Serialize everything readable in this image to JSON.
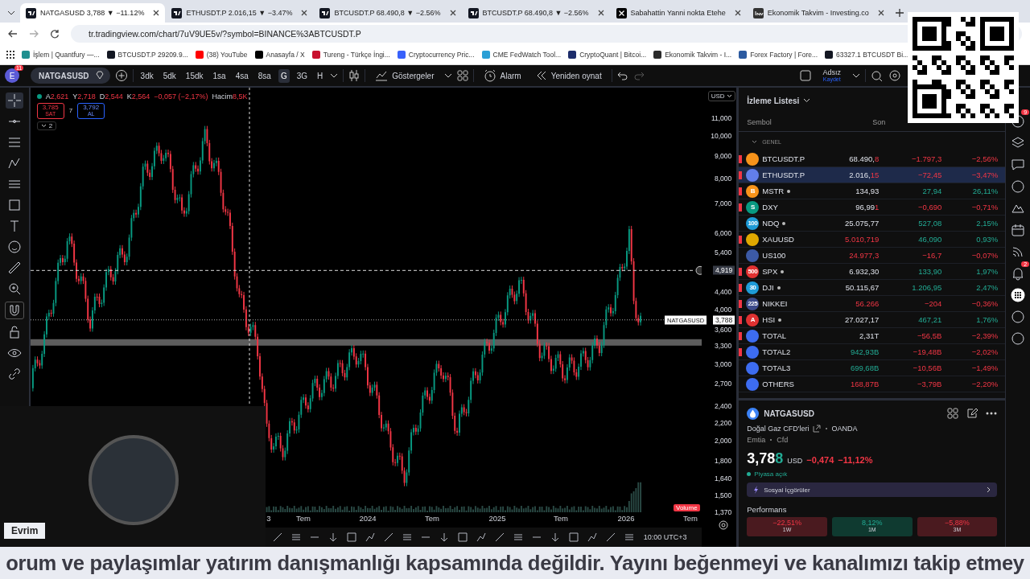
{
  "browser": {
    "tabs": [
      {
        "kind": "tv",
        "title": "NATGASUSD 3,788 ▼ −11.12%",
        "selected": true
      },
      {
        "kind": "tv",
        "title": "ETHUSDT.P 2.016,15 ▼ −3.47%",
        "selected": false
      },
      {
        "kind": "tv",
        "title": "BTCUSDT.P 68.490,8 ▼ −2.56%",
        "selected": false
      },
      {
        "kind": "tv",
        "title": "BTCUSDT.P 68.490,8 ▼ −2.56%",
        "selected": false
      },
      {
        "kind": "x",
        "title": "Sabahattin Yanni nokta Etehe",
        "selected": false
      },
      {
        "kind": "inv",
        "title": "Ekonomik Takvim - Investing.co",
        "selected": false
      }
    ],
    "url": "tr.tradingview.com/chart/7uV9UE5v/?symbol=BINANCE%3ABTCUSDT.P",
    "bookmarks": [
      {
        "title": "İşlem | Quantfury —...",
        "color": "#1f8f8f"
      },
      {
        "title": "BTCUSDT.P 29209.9...",
        "color": "#131722"
      },
      {
        "title": "(38) YouTube",
        "color": "#ff0000"
      },
      {
        "title": "Anasayfa / X",
        "color": "#000000"
      },
      {
        "title": "Tureng - Türkçe İngi...",
        "color": "#c8102e"
      },
      {
        "title": "Cryptocurrency Pric...",
        "color": "#3861fb"
      },
      {
        "title": "CME FedWatch Tool...",
        "color": "#2a9fd6"
      },
      {
        "title": "CryptoQuant | Bitcoi...",
        "color": "#1d2d6b"
      },
      {
        "title": "Ekonomik Takvim - I...",
        "color": "#2b2b2b"
      },
      {
        "title": "Forex Factory | Fore...",
        "color": "#2c5aa0"
      },
      {
        "title": "63327.1 BTCUSDT Bi...",
        "color": "#131722"
      }
    ]
  },
  "toolbar": {
    "avatar": "E",
    "notifications": "11",
    "symbol": "NATGASUSD",
    "intervals": [
      {
        "label": "3dk",
        "selected": false
      },
      {
        "label": "5dk",
        "selected": false
      },
      {
        "label": "15dk",
        "selected": false
      },
      {
        "label": "1sa",
        "selected": false
      },
      {
        "label": "4sa",
        "selected": false
      },
      {
        "label": "8sa",
        "selected": false
      },
      {
        "label": "G",
        "selected": true
      },
      {
        "label": "3G",
        "selected": false
      },
      {
        "label": "H",
        "selected": false
      }
    ],
    "indicators": "Göstergeler",
    "alert": "Alarm",
    "replay": "Yeniden oynat",
    "layout_name": "Adsız",
    "layout_save": "Kaydet"
  },
  "chart": {
    "legend": [
      {
        "label": "A",
        "value": "2,621"
      },
      {
        "label": "Y",
        "value": "2,718"
      },
      {
        "label": "D",
        "value": "2,544"
      },
      {
        "label": "K",
        "value": "2,564"
      }
    ],
    "change": "−0,057 (−2,17%)",
    "volume_label": "Hacim",
    "volume_value": "8,5K",
    "sell_price": "3,785",
    "sell_label": "SAT",
    "spread": "7",
    "buy_price": "3,792",
    "buy_label": "AL",
    "collapsed_count": "2",
    "currency": "USD",
    "price_ticks": [
      "11,000",
      "10,000",
      "9,000",
      "8,000",
      "7,000",
      "6,000",
      "5,400",
      "4,400",
      "4,000",
      "3,600",
      "3,300",
      "3,000",
      "2,700",
      "2,400",
      "2,200",
      "2,000",
      "1,800",
      "1,640",
      "1,500",
      "1,370"
    ],
    "crosshair_price": "4,919",
    "last_symbol": "NATGASUSD",
    "last_price": "3,788",
    "time_ticks": [
      "3",
      "Tem",
      "2024",
      "Tem",
      "2025",
      "Tem",
      "2026",
      "Tem"
    ],
    "volume_tag": "Volume",
    "timezone": "10:00 UTC+3"
  },
  "webcam": {
    "name": "Evrim"
  },
  "watchlist": {
    "title": "İzleme Listesi",
    "columns": [
      "Sembol",
      "Son"
    ],
    "group": "GENEL",
    "rows": [
      {
        "symbol": "BTCUSDT.P",
        "color": "#f7931a",
        "badge": "",
        "live": false,
        "flagged": true,
        "last": "68.490,",
        "last_tick": "8",
        "last_up": false,
        "last_down": false,
        "change": "−1.797,3",
        "change_pct": "−2,56%",
        "negative": true,
        "selected": false
      },
      {
        "symbol": "ETHUSDT.P",
        "color": "#627eea",
        "badge": "",
        "live": false,
        "flagged": true,
        "last": "2.016,",
        "last_tick": "15",
        "last_up": false,
        "last_down": false,
        "change": "−72,45",
        "change_pct": "−3,47%",
        "negative": true,
        "selected": true
      },
      {
        "symbol": "MSTR",
        "color": "#f7931a",
        "badge": "B",
        "live": true,
        "flagged": true,
        "last": "134,93",
        "last_tick": "",
        "last_up": false,
        "last_down": false,
        "change": "27,94",
        "change_pct": "26,11%",
        "negative": false,
        "selected": false
      },
      {
        "symbol": "DXY",
        "color": "#089981",
        "badge": "S",
        "live": false,
        "flagged": true,
        "last": "96,99",
        "last_tick": "1",
        "last_up": false,
        "last_down": false,
        "change": "−0,690",
        "change_pct": "−0,71%",
        "negative": true,
        "selected": false
      },
      {
        "symbol": "NDQ",
        "color": "#1e9bd7",
        "badge": "100",
        "live": true,
        "flagged": false,
        "last": "25.075,77",
        "last_tick": "",
        "last_up": false,
        "last_down": false,
        "change": "527,08",
        "change_pct": "2,15%",
        "negative": false,
        "selected": false
      },
      {
        "symbol": "XAUUSD",
        "color": "#e0a800",
        "badge": "",
        "live": false,
        "flagged": true,
        "last": "5.010,71",
        "last_tick": "9",
        "last_up": false,
        "last_down": true,
        "change": "46,090",
        "change_pct": "0,93%",
        "negative": false,
        "selected": false
      },
      {
        "symbol": "US100",
        "color": "#3c5aa6",
        "badge": "",
        "live": false,
        "flagged": false,
        "last": "24.977,3",
        "last_tick": "",
        "last_up": false,
        "last_down": true,
        "change": "−16,7",
        "change_pct": "−0,07%",
        "negative": true,
        "selected": false
      },
      {
        "symbol": "SPX",
        "color": "#e03131",
        "badge": "500",
        "live": true,
        "flagged": true,
        "last": "6.932,30",
        "last_tick": "",
        "last_up": false,
        "last_down": false,
        "change": "133,90",
        "change_pct": "1,97%",
        "negative": false,
        "selected": false
      },
      {
        "symbol": "DJI",
        "color": "#1e9bd7",
        "badge": "30",
        "live": true,
        "flagged": true,
        "last": "50.115,67",
        "last_tick": "",
        "last_up": false,
        "last_down": false,
        "change": "1.206,95",
        "change_pct": "2,47%",
        "negative": false,
        "selected": false
      },
      {
        "symbol": "NIKKEI",
        "color": "#3c4a8a",
        "badge": "225",
        "live": false,
        "flagged": true,
        "last": "56.266",
        "last_tick": "",
        "last_up": false,
        "last_down": true,
        "change": "−204",
        "change_pct": "−0,36%",
        "negative": true,
        "selected": false
      },
      {
        "symbol": "HSI",
        "color": "#e03131",
        "badge": "A",
        "live": true,
        "flagged": true,
        "last": "27.027,17",
        "last_tick": "",
        "last_up": false,
        "last_down": false,
        "change": "467,21",
        "change_pct": "1,76%",
        "negative": false,
        "selected": false
      },
      {
        "symbol": "TOTAL",
        "color": "#3d6cf0",
        "badge": "",
        "live": false,
        "flagged": true,
        "last": "2,31T",
        "last_tick": "",
        "last_up": false,
        "last_down": false,
        "change": "−56,5B",
        "change_pct": "−2,39%",
        "negative": true,
        "selected": false
      },
      {
        "symbol": "TOTAL2",
        "color": "#3d6cf0",
        "badge": "",
        "live": false,
        "flagged": true,
        "last": "942,93B",
        "last_tick": "",
        "last_up": true,
        "last_down": false,
        "change": "−19,48B",
        "change_pct": "−2,02%",
        "negative": true,
        "selected": false
      },
      {
        "symbol": "TOTAL3",
        "color": "#3d6cf0",
        "badge": "",
        "live": false,
        "flagged": false,
        "last": "699,68B",
        "last_tick": "",
        "last_up": true,
        "last_down": false,
        "change": "−10,56B",
        "change_pct": "−1,49%",
        "negative": true,
        "selected": false
      },
      {
        "symbol": "OTHERS",
        "color": "#3d6cf0",
        "badge": "",
        "live": false,
        "flagged": false,
        "last": "168,87B",
        "last_tick": "",
        "last_up": false,
        "last_down": true,
        "change": "−3,79B",
        "change_pct": "−2,20%",
        "negative": true,
        "selected": false
      }
    ]
  },
  "details": {
    "symbol": "NATGASUSD",
    "description": "Doğal Gaz CFD'leri",
    "exchange": "OANDA",
    "category": "Emtia",
    "type": "Cfd",
    "price": "3,78",
    "price_tick": "8",
    "currency": "USD",
    "change": "−0,474",
    "change_pct": "−11,12%",
    "market_status": "Piyasa açık",
    "insights": "Sosyal İçgörüler",
    "performance_title": "Performans",
    "performance": [
      {
        "value": "−22,51%",
        "period": "1W",
        "negative": true
      },
      {
        "value": "8,12%",
        "period": "1M",
        "negative": false
      },
      {
        "value": "−5,88%",
        "period": "3M",
        "negative": true
      }
    ]
  },
  "right_rail": {
    "badges": [
      "9",
      "2"
    ]
  },
  "ticker": "orum ve paylaşımlar yatırım danışmanlığı kapsamında değildir. Yayını beğenmeyi ve kanalımızı takip etmey"
}
